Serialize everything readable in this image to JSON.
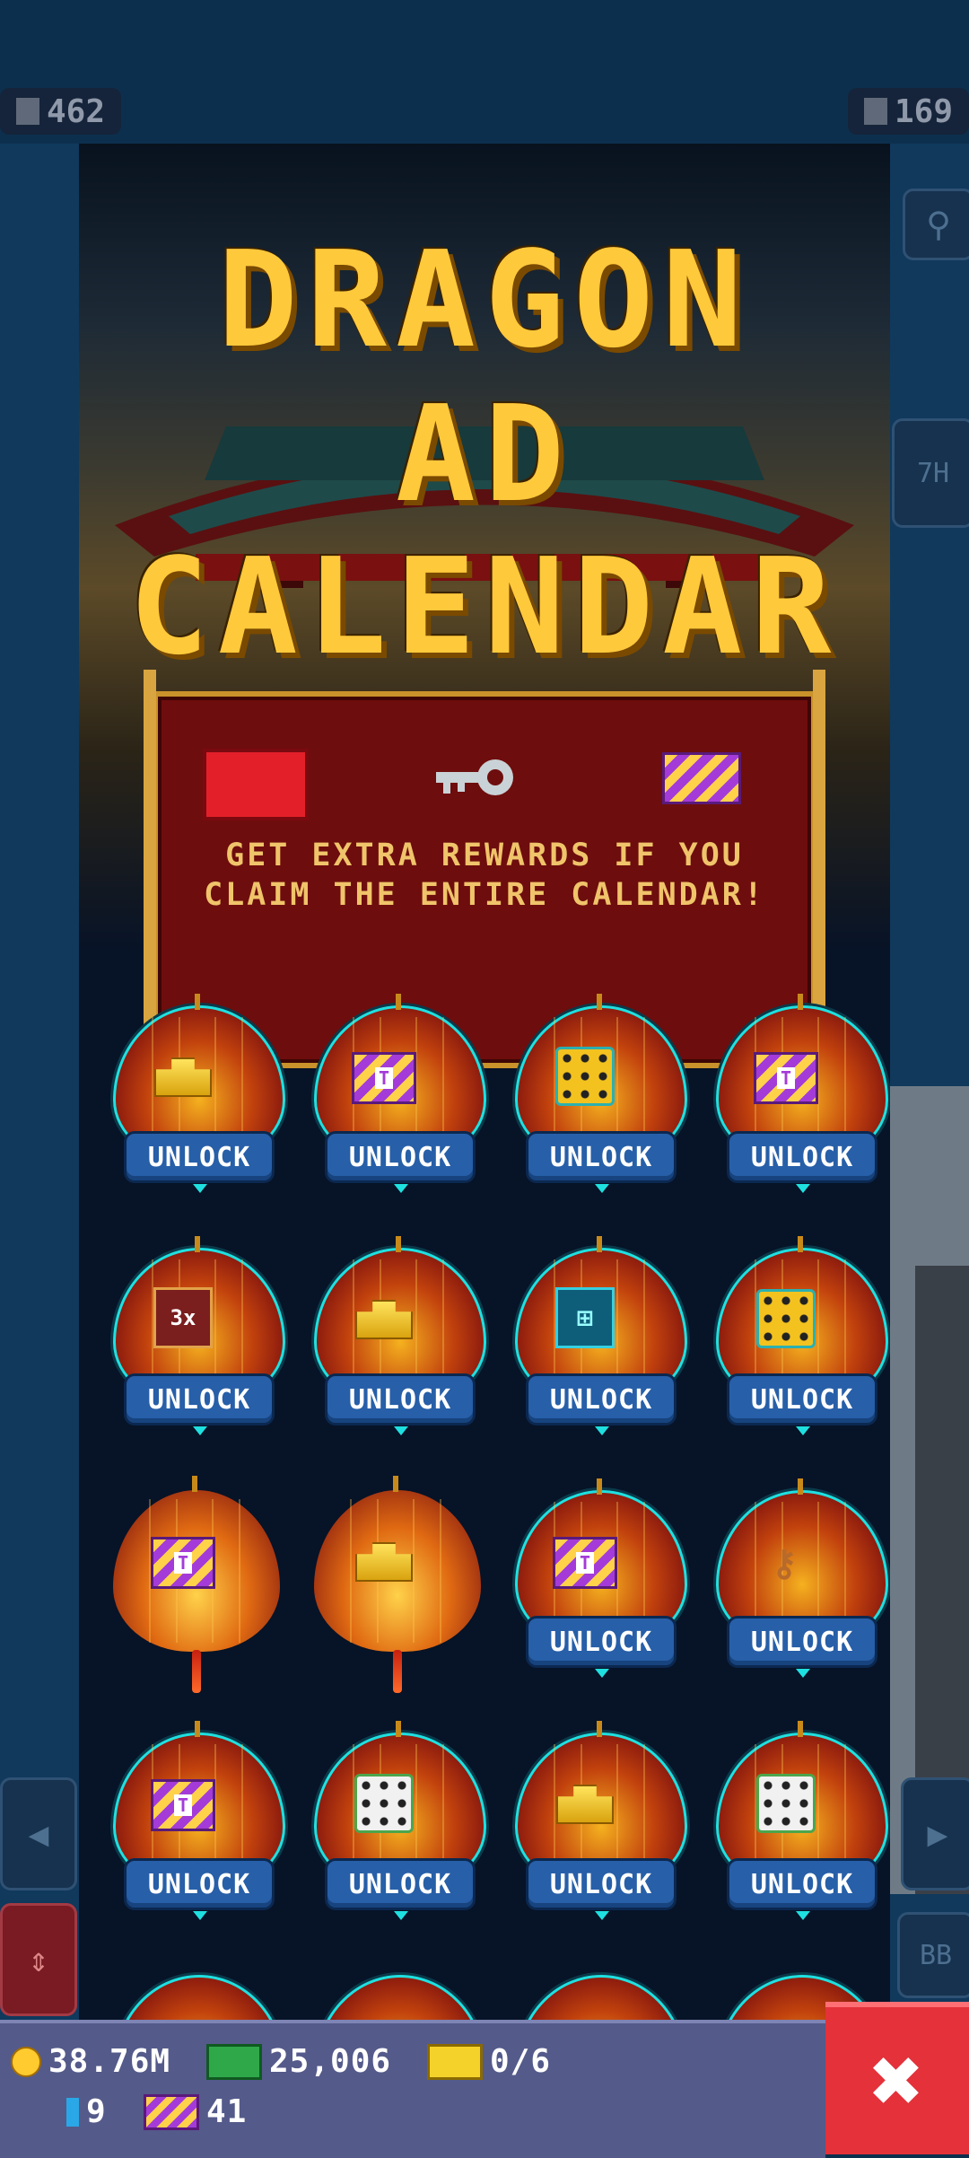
{
  "hud": {
    "population": "462",
    "floors": "169",
    "right_tab": "7H",
    "right_label": "BB"
  },
  "title": {
    "line1": "DRAGON",
    "line2": "AD",
    "line3": "CALENDAR"
  },
  "banner": {
    "rewards": [
      "chest",
      "key",
      "ticket"
    ],
    "text_line1": "GET EXTRA REWARDS IF YOU",
    "text_line2": "CLAIM THE ENTIRE CALENDAR!"
  },
  "unlock_label": "UNLOCK",
  "calendar": [
    {
      "item": "gold",
      "state": "locked"
    },
    {
      "item": "ticket",
      "state": "locked"
    },
    {
      "item": "dice-yellow",
      "state": "locked"
    },
    {
      "item": "ticket",
      "state": "locked"
    },
    {
      "item": "boost-3x",
      "state": "locked",
      "text": "3x"
    },
    {
      "item": "gold",
      "state": "locked"
    },
    {
      "item": "auto",
      "state": "locked"
    },
    {
      "item": "dice-yellow",
      "state": "locked"
    },
    {
      "item": "ticket",
      "state": "opened"
    },
    {
      "item": "gold",
      "state": "opened"
    },
    {
      "item": "ticket",
      "state": "locked"
    },
    {
      "item": "key",
      "state": "locked"
    },
    {
      "item": "ticket",
      "state": "locked"
    },
    {
      "item": "dice-white",
      "state": "locked"
    },
    {
      "item": "gold",
      "state": "locked"
    },
    {
      "item": "dice-white",
      "state": "locked"
    }
  ],
  "currency": {
    "coins": "38.76M",
    "cash": "25,006",
    "tickets": "0/6",
    "gems": "9",
    "vip_tickets": "41"
  },
  "colors": {
    "title": "#ffc93c",
    "unlock_button": "#275fa8",
    "close_button": "#e4313a",
    "bottom_bar": "#545a8a"
  }
}
